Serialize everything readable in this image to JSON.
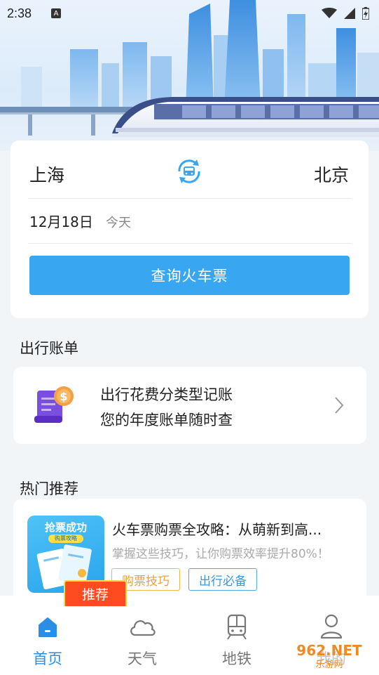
{
  "status_bar": {
    "time": "2:38",
    "indicator": "A"
  },
  "search": {
    "from_city": "上海",
    "to_city": "北京",
    "date": "12月18日",
    "date_note": "今天",
    "button_label": "查询火车票"
  },
  "bill_section": {
    "title": "出行账单",
    "line1": "出行花费分类型记账",
    "line2": "您的年度账单随时查"
  },
  "hot_section": {
    "title": "热门推荐",
    "thumb_title": "抢票成功",
    "thumb_pill": "购票攻略",
    "article_title": "火车票购票全攻略：从萌新到高...",
    "article_desc": "掌握这些技巧，让你购票效率提升80%！",
    "tags": [
      "购票技巧",
      "出行必备"
    ],
    "badge": "推荐"
  },
  "nav": {
    "items": [
      {
        "label": "首页",
        "icon": "home-icon",
        "active": true
      },
      {
        "label": "天气",
        "icon": "cloud-icon",
        "active": false
      },
      {
        "label": "地铁",
        "icon": "subway-icon",
        "active": false
      },
      {
        "label": "我的",
        "icon": "user-icon",
        "active": false
      }
    ]
  },
  "watermark": {
    "text": "962.NET",
    "sub": "乐游网"
  },
  "colors": {
    "accent": "#39a6f2",
    "active_nav": "#2a8fe4",
    "badge": "#ff4b1f"
  }
}
